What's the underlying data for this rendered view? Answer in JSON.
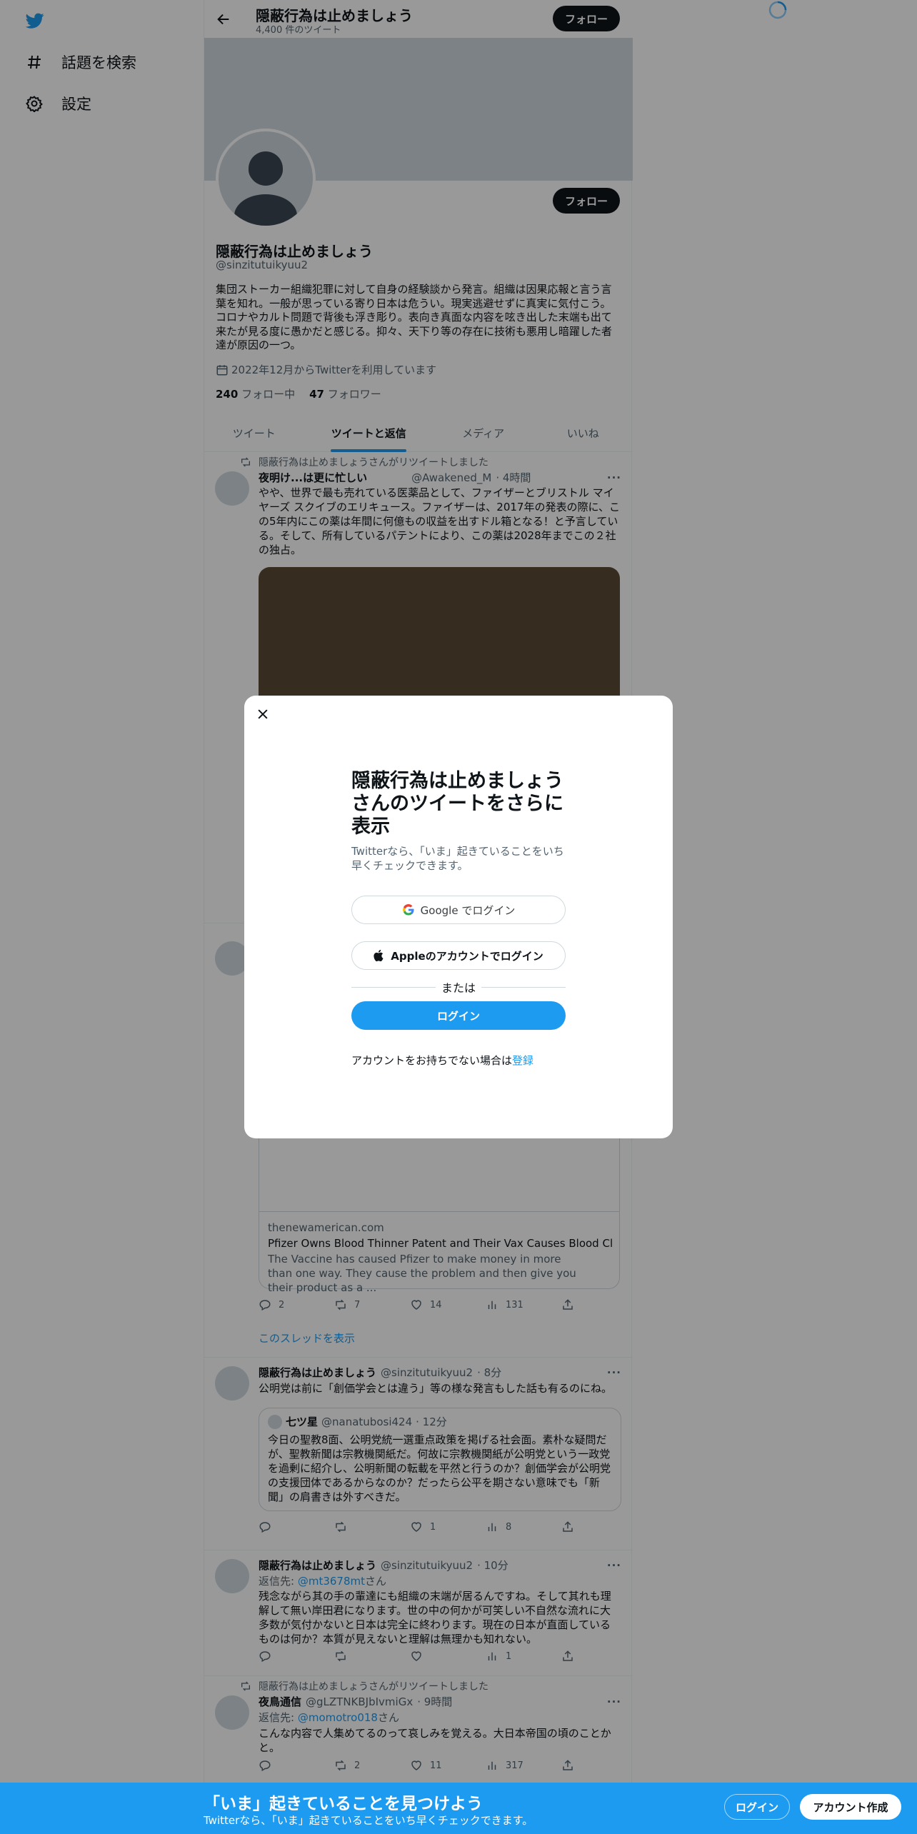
{
  "nav": {
    "items": [
      {
        "label": "話題を検索",
        "icon": "hashtag-icon"
      },
      {
        "label": "設定",
        "icon": "gear-icon"
      }
    ]
  },
  "header": {
    "title": "隠蔽行為は止めましょう",
    "tweet_count": "4,400 件のツイート",
    "follow_label": "フォロー"
  },
  "profile": {
    "follow_label": "フォロー",
    "name": "隠蔽行為は止めましょう",
    "handle": "@sinzitutuikyuu2",
    "bio": "集団ストーカー組織犯罪に対して自身の経験談から発言。組織は因果応報と言う言葉を知れ。一般が思っている寄り日本は危うい。現実逃避せずに真実に気付こう。コロナやカルト問題で背後も浮き彫り。表向き真面な内容を呟き出した末端も出て来たが見る度に愚かだと感じる。抑々、天下り等の存在に技術も悪用し暗躍した者達が原因の一つ。",
    "joined": "2022年12月からTwitterを利用しています",
    "following_count": "240",
    "following_label": "フォロー中",
    "followers_count": "47",
    "followers_label": "フォロワー"
  },
  "tabs": [
    {
      "label": "ツイート",
      "active": false
    },
    {
      "label": "ツイートと返信",
      "active": true
    },
    {
      "label": "メディア",
      "active": false
    },
    {
      "label": "いいね",
      "active": false
    }
  ],
  "tweets": {
    "t1": {
      "context": "隠蔽行為は止めましょうさんがリツイートしました",
      "name": "夜明け...は更に忙しい",
      "handle": "@Awakened_M",
      "time": "· 4時間",
      "text": "やや、世界で最も売れている医薬品として、ファイザーとブリストル マイヤーズ スクイブのエリキュース。ファイザーは、2017年の発表の際に、この5年内にこの薬は年間に何億もの収益を出すドル箱となる！と予言している。そして、所有しているパテントにより、この薬は2028年までこの２社の独占。"
    },
    "t2": {
      "link_domain": "thenewamerican.com",
      "link_title": "Pfizer Owns Blood Thinner Patent and Their Vax Causes Blood Clots! ...",
      "link_desc": "The Vaccine has caused Pfizer to make money in more than one way. They cause the problem and then give you their product as a ...",
      "replies": "2",
      "retweets": "7",
      "likes": "14",
      "views": "131",
      "show_thread": "このスレッドを表示"
    },
    "t3": {
      "name": "隠蔽行為は止めましょう",
      "handle": "@sinzitutuikyuu2",
      "time": "· 8分",
      "text": "公明党は前に「創価学会とは違う」等の様な発言もした話も有るのにね。",
      "quote_name": "七ツ星",
      "quote_handle": "@nanatubosi424",
      "quote_time": "· 12分",
      "quote_text": "今日の聖教8面、公明党統一選重点政策を掲げる社会面。素朴な疑問だが、聖教新聞は宗教機関紙だ。何故に宗教機関紙が公明党という一政党を過剰に紹介し、公明新聞の転載を平然と行うのか？創価学会が公明党の支援団体であるからなのか？だったら公平を期さない意味でも「新聞」の肩書きは外すべきだ。",
      "replies": "",
      "retweets": "",
      "likes": "1",
      "views": "8"
    },
    "t4": {
      "name": "隠蔽行為は止めましょう",
      "handle": "@sinzitutuikyuu2",
      "time": "· 10分",
      "reply_prefix": "返信先:",
      "reply_to": "@mt3678mt",
      "reply_suffix": "さん",
      "text": "残念ながら其の手の輩達にも組織の末端が居るんですね。そして其れも理解して無い岸田君になります。世の中の何かが可笑しい不自然な流れに大多数が気付かないと日本は完全に終わります。現在の日本が直面しているものは何か？本質が見えないと理解は無理かも知れない。",
      "views": "1"
    },
    "t5": {
      "context": "隠蔽行為は止めましょうさんがリツイートしました",
      "name": "夜鳥通信",
      "handle": "@gLZTNKBJbIvmiGx",
      "time": "· 9時間",
      "reply_prefix": "返信先:",
      "reply_to": "@momotro018",
      "reply_suffix": "さん",
      "text": "こんな内容で人集めてるのって哀しみを覚える。大日本帝国の頃のことかと。",
      "retweets": "2",
      "likes": "11",
      "views": "317"
    }
  },
  "modal": {
    "title": "隠蔽行為は止めましょうさんのツイートをさらに表示",
    "subtitle": "Twitterなら、「いま」起きていることをいち早くチェックできます。",
    "google_label": "Google でログイン",
    "apple_label": "Appleのアカウントでログイン",
    "or_label": "または",
    "login_label": "ログイン",
    "signup_prompt": "アカウントをお持ちでない場合は",
    "signup_link": "登録"
  },
  "bottom_bar": {
    "headline": "「いま」起きていることを見つけよう",
    "subline": "Twitterなら、「いま」起きていることをいち早くチェックできます。",
    "login_label": "ログイン",
    "signup_label": "アカウント作成"
  },
  "colors": {
    "accent": "#1d9bf0",
    "banner": "#cfd9de",
    "media": "#5c4a36"
  }
}
